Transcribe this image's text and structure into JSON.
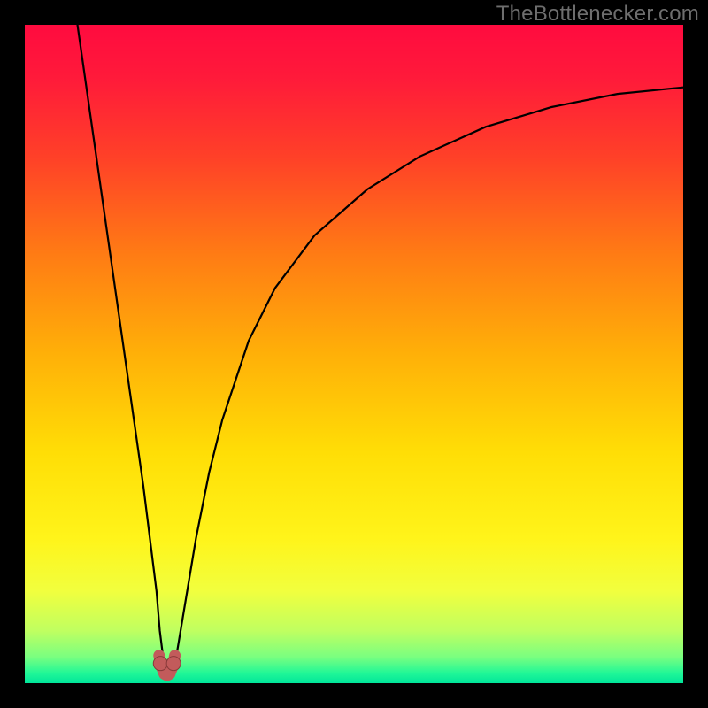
{
  "watermark": {
    "text": "TheBottlenecker.com"
  },
  "colors": {
    "gradient_stops": [
      {
        "offset": 0.0,
        "color": "#ff0b3f"
      },
      {
        "offset": 0.08,
        "color": "#ff1a3a"
      },
      {
        "offset": 0.2,
        "color": "#ff4028"
      },
      {
        "offset": 0.35,
        "color": "#ff7c14"
      },
      {
        "offset": 0.5,
        "color": "#ffb008"
      },
      {
        "offset": 0.65,
        "color": "#ffde06"
      },
      {
        "offset": 0.78,
        "color": "#fff41a"
      },
      {
        "offset": 0.86,
        "color": "#f1ff3e"
      },
      {
        "offset": 0.92,
        "color": "#c0ff60"
      },
      {
        "offset": 0.96,
        "color": "#7aff80"
      },
      {
        "offset": 0.985,
        "color": "#20f797"
      },
      {
        "offset": 1.0,
        "color": "#00e59a"
      }
    ],
    "curve": "#000000",
    "marker_fill": "#c25b5b",
    "marker_stroke": "#8a3a3a"
  },
  "chart_data": {
    "type": "line",
    "title": "",
    "xlabel": "",
    "ylabel": "",
    "xlim": [
      0,
      100
    ],
    "ylim": [
      0,
      100
    ],
    "grid": false,
    "legend": null,
    "series": [
      {
        "name": "bottleneck-curve",
        "x": [
          8,
          10,
          12,
          14,
          16,
          18,
          19,
          20,
          20.5,
          21,
          21.6,
          22.2,
          23,
          24,
          26,
          28,
          30,
          34,
          38,
          44,
          52,
          60,
          70,
          80,
          90,
          100
        ],
        "y": [
          100,
          86,
          72,
          58,
          44,
          30,
          22,
          14,
          8,
          4,
          1.5,
          1.5,
          4,
          10,
          22,
          32,
          40,
          52,
          60,
          68,
          75,
          80,
          84.5,
          87.5,
          89.5,
          90.5
        ]
      }
    ],
    "markers": [
      {
        "name": "valley-left",
        "x": 20.6,
        "y": 3.0
      },
      {
        "name": "valley-right",
        "x": 22.6,
        "y": 3.0
      }
    ],
    "valley_path": {
      "note": "short U-shaped colored segment at curve minimum",
      "x": [
        20.4,
        20.8,
        21.2,
        21.6,
        22.0,
        22.4,
        22.8
      ],
      "y": [
        4.2,
        2.4,
        1.4,
        1.2,
        1.4,
        2.4,
        4.2
      ]
    }
  }
}
